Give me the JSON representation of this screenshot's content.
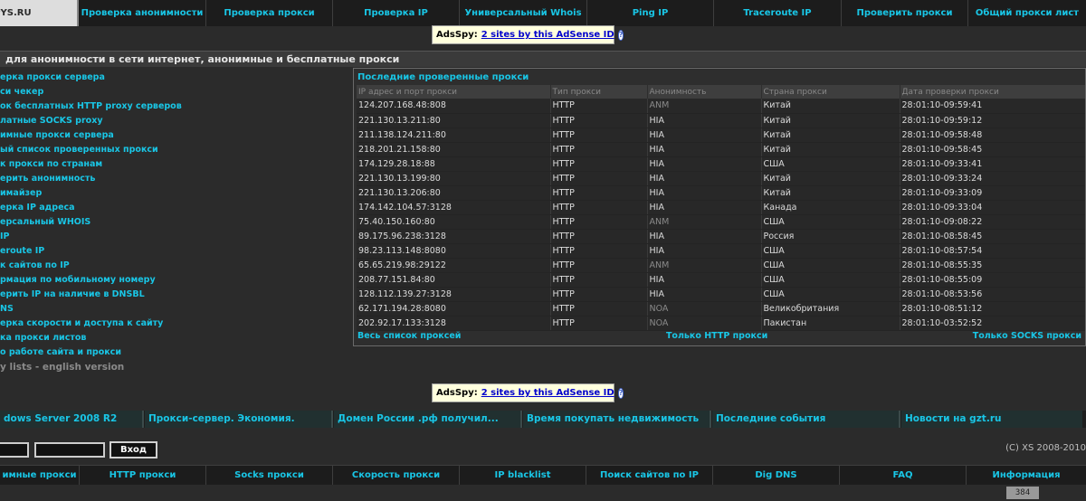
{
  "topnav": {
    "brand": "SPYS.RU",
    "items": [
      "Проверка анонимности",
      "Проверка прокси",
      "Проверка IP",
      "Универсальный Whois",
      "Ping IP",
      "Traceroute IP",
      "Проверить прокси",
      "Общий прокси лист"
    ]
  },
  "ad_top": {
    "label": "AdsSpy:",
    "link": "2 sites by this AdSense ID",
    "icon": "question-icon"
  },
  "ad_bottom": {
    "label": "AdsSpy:",
    "link": "2 sites by this AdSense ID",
    "icon": "question-icon"
  },
  "title": "для анонимности в сети интернет, анонимные и бесплатные прокси",
  "leftmenu": [
    "ерка прокси сервера",
    "си чекер",
    "ок бесплатных HTTP proxy серверов",
    "латные SOCKS proxy",
    "имные прокси сервера",
    "ый список проверенных прокси",
    "к прокси по странам",
    "ерить анонимность",
    "имайзер",
    "ерка IP адреса",
    "ерсальный WHOIS",
    "IP",
    "eroute IP",
    "к сайтов по IP",
    "рмация по мобильному номеру",
    "ерить IP на наличие в DNSBL",
    "NS",
    "ерка скорости и доступа к сайту",
    "ка прокси листов",
    "о работе сайта и прокси",
    "y lists - english version"
  ],
  "proxy_panel": {
    "title": "Последние проверенные прокси",
    "headers": [
      "IP адрес и порт прокси",
      "Тип прокси",
      "Анонимность",
      "Страна прокси",
      "Дата проверки прокси"
    ],
    "rows": [
      [
        "124.207.168.48:808",
        "HTTP",
        "ANM",
        "Китай",
        "28:01:10-09:59:41"
      ],
      [
        "221.130.13.211:80",
        "HTTP",
        "HIA",
        "Китай",
        "28:01:10-09:59:12"
      ],
      [
        "211.138.124.211:80",
        "HTTP",
        "HIA",
        "Китай",
        "28:01:10-09:58:48"
      ],
      [
        "218.201.21.158:80",
        "HTTP",
        "HIA",
        "Китай",
        "28:01:10-09:58:45"
      ],
      [
        "174.129.28.18:88",
        "HTTP",
        "HIA",
        "США",
        "28:01:10-09:33:41"
      ],
      [
        "221.130.13.199:80",
        "HTTP",
        "HIA",
        "Китай",
        "28:01:10-09:33:24"
      ],
      [
        "221.130.13.206:80",
        "HTTP",
        "HIA",
        "Китай",
        "28:01:10-09:33:09"
      ],
      [
        "174.142.104.57:3128",
        "HTTP",
        "HIA",
        "Канада",
        "28:01:10-09:33:04"
      ],
      [
        "75.40.150.160:80",
        "HTTP",
        "ANM",
        "США",
        "28:01:10-09:08:22"
      ],
      [
        "89.175.96.238:3128",
        "HTTP",
        "HIA",
        "Россия",
        "28:01:10-08:58:45"
      ],
      [
        "98.23.113.148:8080",
        "HTTP",
        "HIA",
        "США",
        "28:01:10-08:57:54"
      ],
      [
        "65.65.219.98:29122",
        "HTTP",
        "ANM",
        "США",
        "28:01:10-08:55:35"
      ],
      [
        "208.77.151.84:80",
        "HTTP",
        "HIA",
        "США",
        "28:01:10-08:55:09"
      ],
      [
        "128.112.139.27:3128",
        "HTTP",
        "HIA",
        "США",
        "28:01:10-08:53:56"
      ],
      [
        "62.171.194.28:8080",
        "HTTP",
        "NOA",
        "Великобритания",
        "28:01:10-08:51:12"
      ],
      [
        "202.92.17.133:3128",
        "HTTP",
        "NOA",
        "Пакистан",
        "28:01:10-03:52:52"
      ]
    ],
    "footer": {
      "all": "Весь список проксей",
      "http": "Только HTTP прокси",
      "socks": "Только SOCKS прокси"
    }
  },
  "news": [
    "dows Server 2008 R2",
    "Прокси-сервер. Экономия.",
    "Домен России .рф получил...",
    "Время покупать недвижимость",
    "Последние события",
    "Новости на gzt.ru"
  ],
  "login": {
    "button": "Вход"
  },
  "copyright": "(C) XS 2008-2010",
  "bottomnav": [
    "имные прокси",
    "HTTP прокси",
    "Socks прокси",
    "Скорость прокси",
    "IP blacklist",
    "Поиск сайтов по IP",
    "Dig DNS",
    "FAQ",
    "Информация"
  ],
  "counter": "384",
  "colors": {
    "link": "#19c6e6",
    "background": "#2b2b2b",
    "ad_bg": "#ffffdd"
  }
}
